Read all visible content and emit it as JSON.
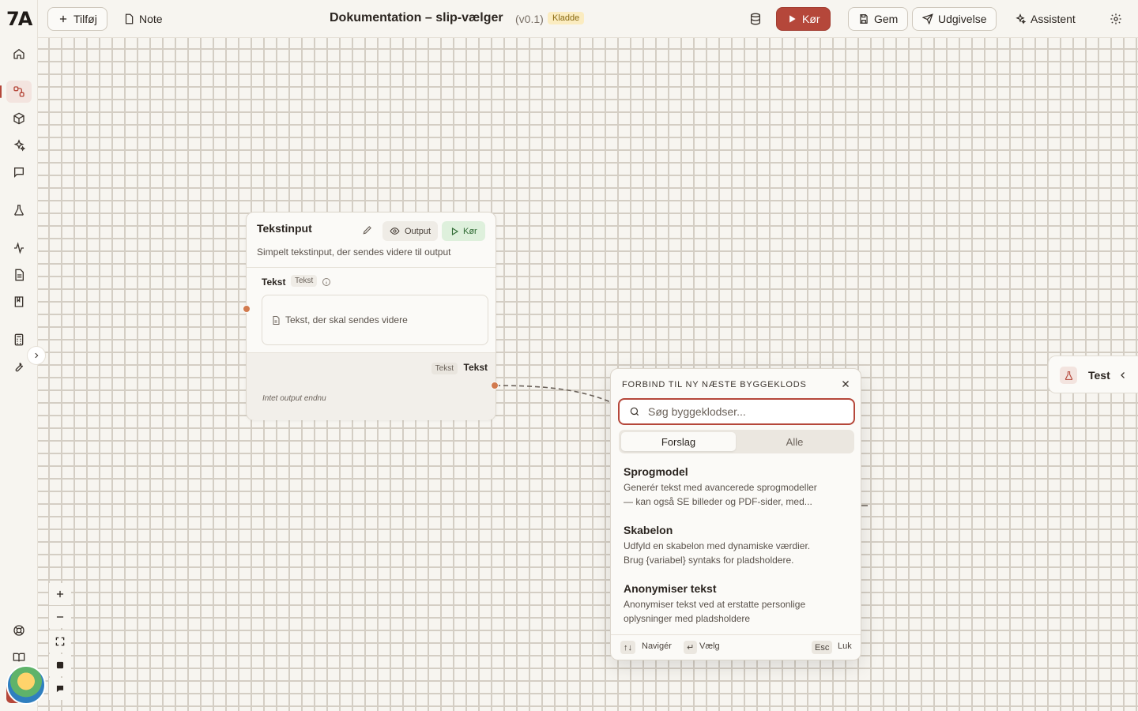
{
  "brand": {
    "logo_text": "7A"
  },
  "topbar": {
    "add_label": "Tilføj",
    "note_label": "Note",
    "title": "Dokumentation – slip-vælger",
    "version": "(v0.1)",
    "status_badge": "Kladde",
    "run_label": "Kør",
    "save_label": "Gem",
    "publish_label": "Udgivelse",
    "assistant_label": "Assistent"
  },
  "sidebar": {
    "items": [
      "home-icon",
      "flow-icon",
      "cube-icon",
      "sparkles-icon",
      "chat-icon",
      "flask-icon",
      "activity-icon",
      "document-icon",
      "book-icon",
      "calculator-icon",
      "wrench-icon"
    ],
    "bottom_items": [
      "help-icon",
      "docs-icon"
    ]
  },
  "node": {
    "title": "Tekstinput",
    "output_btn": "Output",
    "run_btn": "Kør",
    "description": "Simpelt tekstinput, der sendes videre til output",
    "field_label": "Tekst",
    "field_type": "Tekst",
    "field_placeholder": "Tekst, der skal sendes videre",
    "output_type": "Tekst",
    "output_name": "Tekst",
    "output_empty": "Intet output endnu"
  },
  "popup": {
    "title": "FORBIND TIL NY NÆSTE BYGGEKLODS",
    "search_placeholder": "Søg byggeklodser...",
    "tabs": [
      {
        "label": "Forslag",
        "active": true
      },
      {
        "label": "Alle",
        "active": false
      }
    ],
    "items": [
      {
        "name": "Sprogmodel",
        "desc1": "Generér tekst med avancerede sprogmodeller",
        "desc2": "— kan også SE billeder og PDF-sider, med..."
      },
      {
        "name": "Skabelon",
        "desc1": "Udfyld en skabelon med dynamiske værdier.",
        "desc2": "Brug {variabel} syntaks for pladsholdere."
      },
      {
        "name": "Anonymiser tekst",
        "desc1": "Anonymiser tekst ved at erstatte personlige",
        "desc2": "oplysninger med pladsholdere"
      }
    ],
    "footer": {
      "nav_key": "↑↓",
      "nav_label": "Navigér",
      "select_key": "↵",
      "select_label": "Vælg",
      "close_key": "Esc",
      "close_label": "Luk"
    }
  },
  "test_panel": {
    "label": "Test"
  },
  "colors": {
    "accent": "#b5473a",
    "canvas": "#f7f5f0",
    "badge_bg": "#fbecc0"
  }
}
